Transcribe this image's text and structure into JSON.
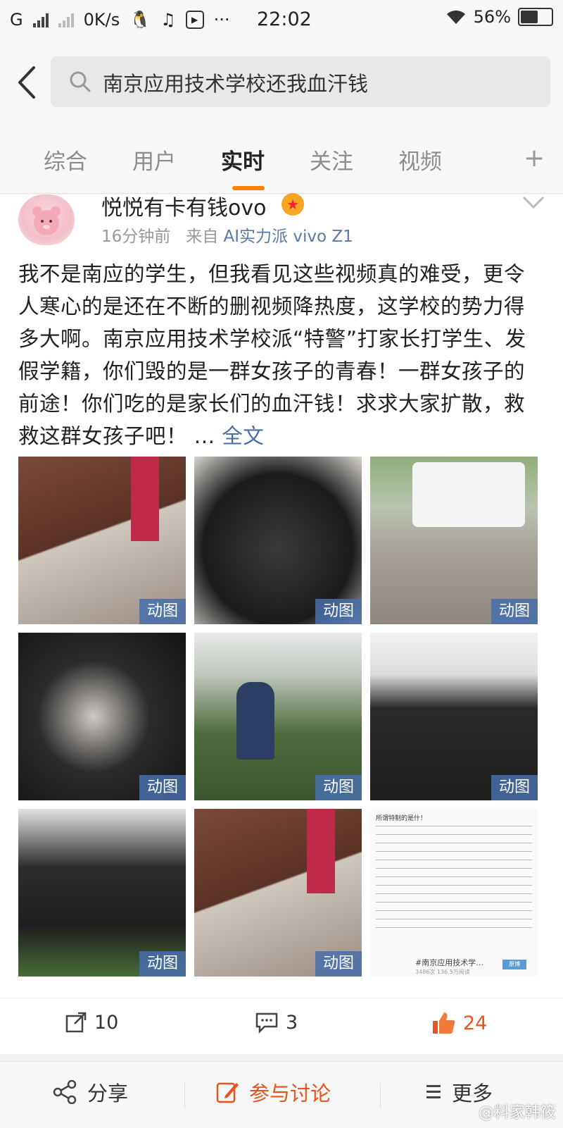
{
  "status_bar": {
    "carrier": "G",
    "net_speed": "0K/s",
    "time": "22:02",
    "battery": "56%"
  },
  "search": {
    "query": "南京应用技术学校还我血汗钱"
  },
  "tabs": [
    {
      "label": "综合"
    },
    {
      "label": "用户"
    },
    {
      "label": "实时"
    },
    {
      "label": "关注"
    },
    {
      "label": "视频"
    }
  ],
  "tab_add": "+",
  "post": {
    "username": "悦悦有卡有钱ovo",
    "time_ago": "16分钟前",
    "source_prefix": "来自",
    "source": "AI实力派 vivo Z1",
    "text": "我不是南应的学生，但我看见这些视频真的难受，更令人寒心的是还在不断的删视频降热度，这学校的势力得多大啊。南京应用技术学校派“特警”打家长打学生、发假学籍，你们毁的是一群女孩子的青春！一群女孩子的前途！你们吃的是家长们的血汗钱！求求大家扩散，救救这群女孩子吧！ ...",
    "more_label": "全文",
    "gif_label": "动图",
    "doc_image": {
      "title": "所谓特制的是什！",
      "hashtag": "#南京应用技术学…",
      "button": "原博",
      "stats": "3486次  136.5万阅读"
    },
    "reposts": "10",
    "comments": "3",
    "likes": "24"
  },
  "bottom_bar": {
    "share": "分享",
    "discuss": "参与讨论",
    "more": "更多"
  },
  "watermark": "@料家韩筱",
  "colors": {
    "accent": "#ff8200",
    "like": "#e8541e",
    "link": "#4a6fa5"
  }
}
